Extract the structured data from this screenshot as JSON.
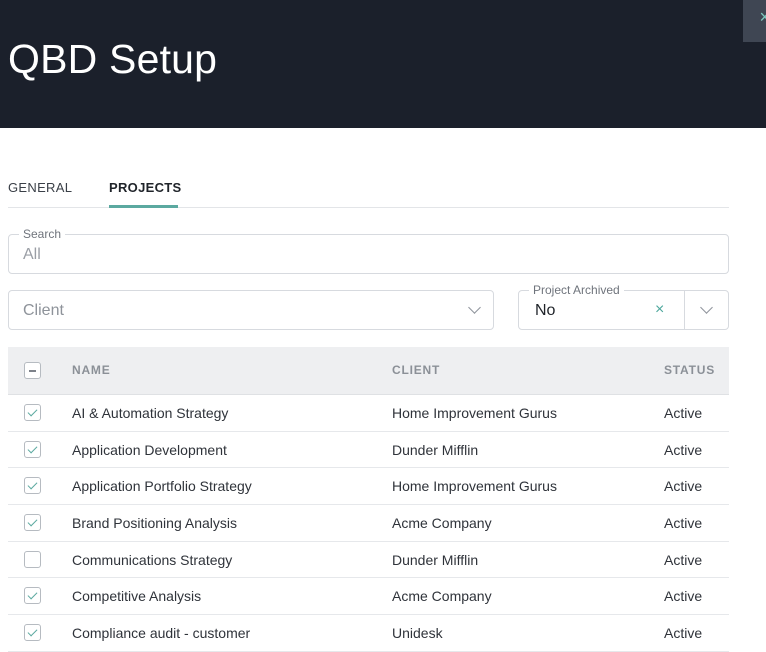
{
  "header": {
    "title": "QBD Setup",
    "close_symbol": "×"
  },
  "tabs": [
    {
      "label": "GENERAL",
      "active": false
    },
    {
      "label": "PROJECTS",
      "active": true
    }
  ],
  "filters": {
    "search": {
      "label": "Search",
      "value": "All"
    },
    "client": {
      "placeholder": "Client"
    },
    "project_archived": {
      "label": "Project Archived",
      "value": "No",
      "clear_symbol": "×"
    }
  },
  "table": {
    "columns": {
      "name": "NAME",
      "client": "CLIENT",
      "status": "STATUS"
    },
    "rows": [
      {
        "name": "AI & Automation Strategy",
        "client": "Home Improvement Gurus",
        "status": "Active",
        "checked": true
      },
      {
        "name": "Application Development",
        "client": "Dunder Mifflin",
        "status": "Active",
        "checked": true
      },
      {
        "name": "Application Portfolio Strategy",
        "client": "Home Improvement Gurus",
        "status": "Active",
        "checked": true
      },
      {
        "name": "Brand Positioning Analysis",
        "client": "Acme Company",
        "status": "Active",
        "checked": true
      },
      {
        "name": "Communications Strategy",
        "client": "Dunder Mifflin",
        "status": "Active",
        "checked": false
      },
      {
        "name": "Competitive Analysis",
        "client": "Acme Company",
        "status": "Active",
        "checked": true
      },
      {
        "name": "Compliance audit - customer",
        "client": "Unidesk",
        "status": "Active",
        "checked": true
      }
    ]
  },
  "colors": {
    "header_bg": "#1b202b",
    "accent": "#5ba9a0"
  }
}
